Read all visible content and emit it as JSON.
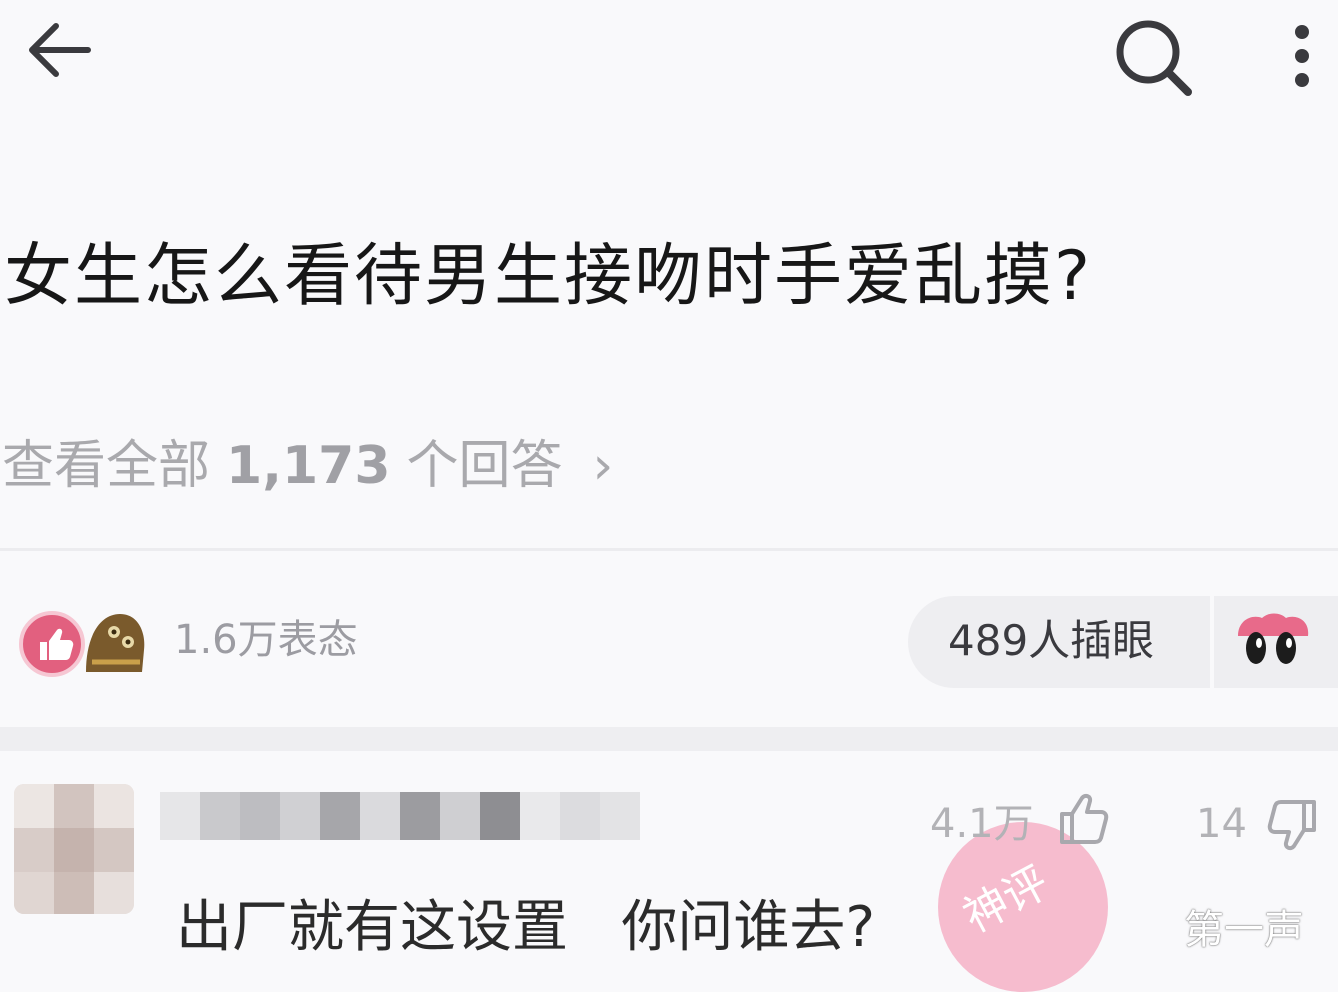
{
  "header": {
    "back_icon": "arrow-left-icon",
    "search_icon": "search-icon",
    "more_icon": "more-vertical-icon"
  },
  "question": {
    "title": "女生怎么看待男生接吻时手爱乱摸?"
  },
  "answers_link": {
    "prefix": "查看全部",
    "count": "1,173",
    "suffix": "个回答",
    "chevron": "›"
  },
  "reactions": {
    "label": "1.6万表态",
    "icons": [
      "thumbs-up-icon",
      "grinning-face-icon"
    ],
    "pill_label": "489人插眼",
    "pill_icon": "peeking-eyes-icon"
  },
  "answer": {
    "text": "出厂就有这设置   你问谁去?",
    "likes": "4.1万",
    "dislikes": "14",
    "sticker_text": "神评"
  },
  "watermark": {
    "text": "第一声"
  },
  "colors": {
    "background": "#f9f9fb",
    "muted_text": "#a9a9ad",
    "pink_badge": "#e2607f",
    "sticker_pink": "#f4a7bf"
  }
}
